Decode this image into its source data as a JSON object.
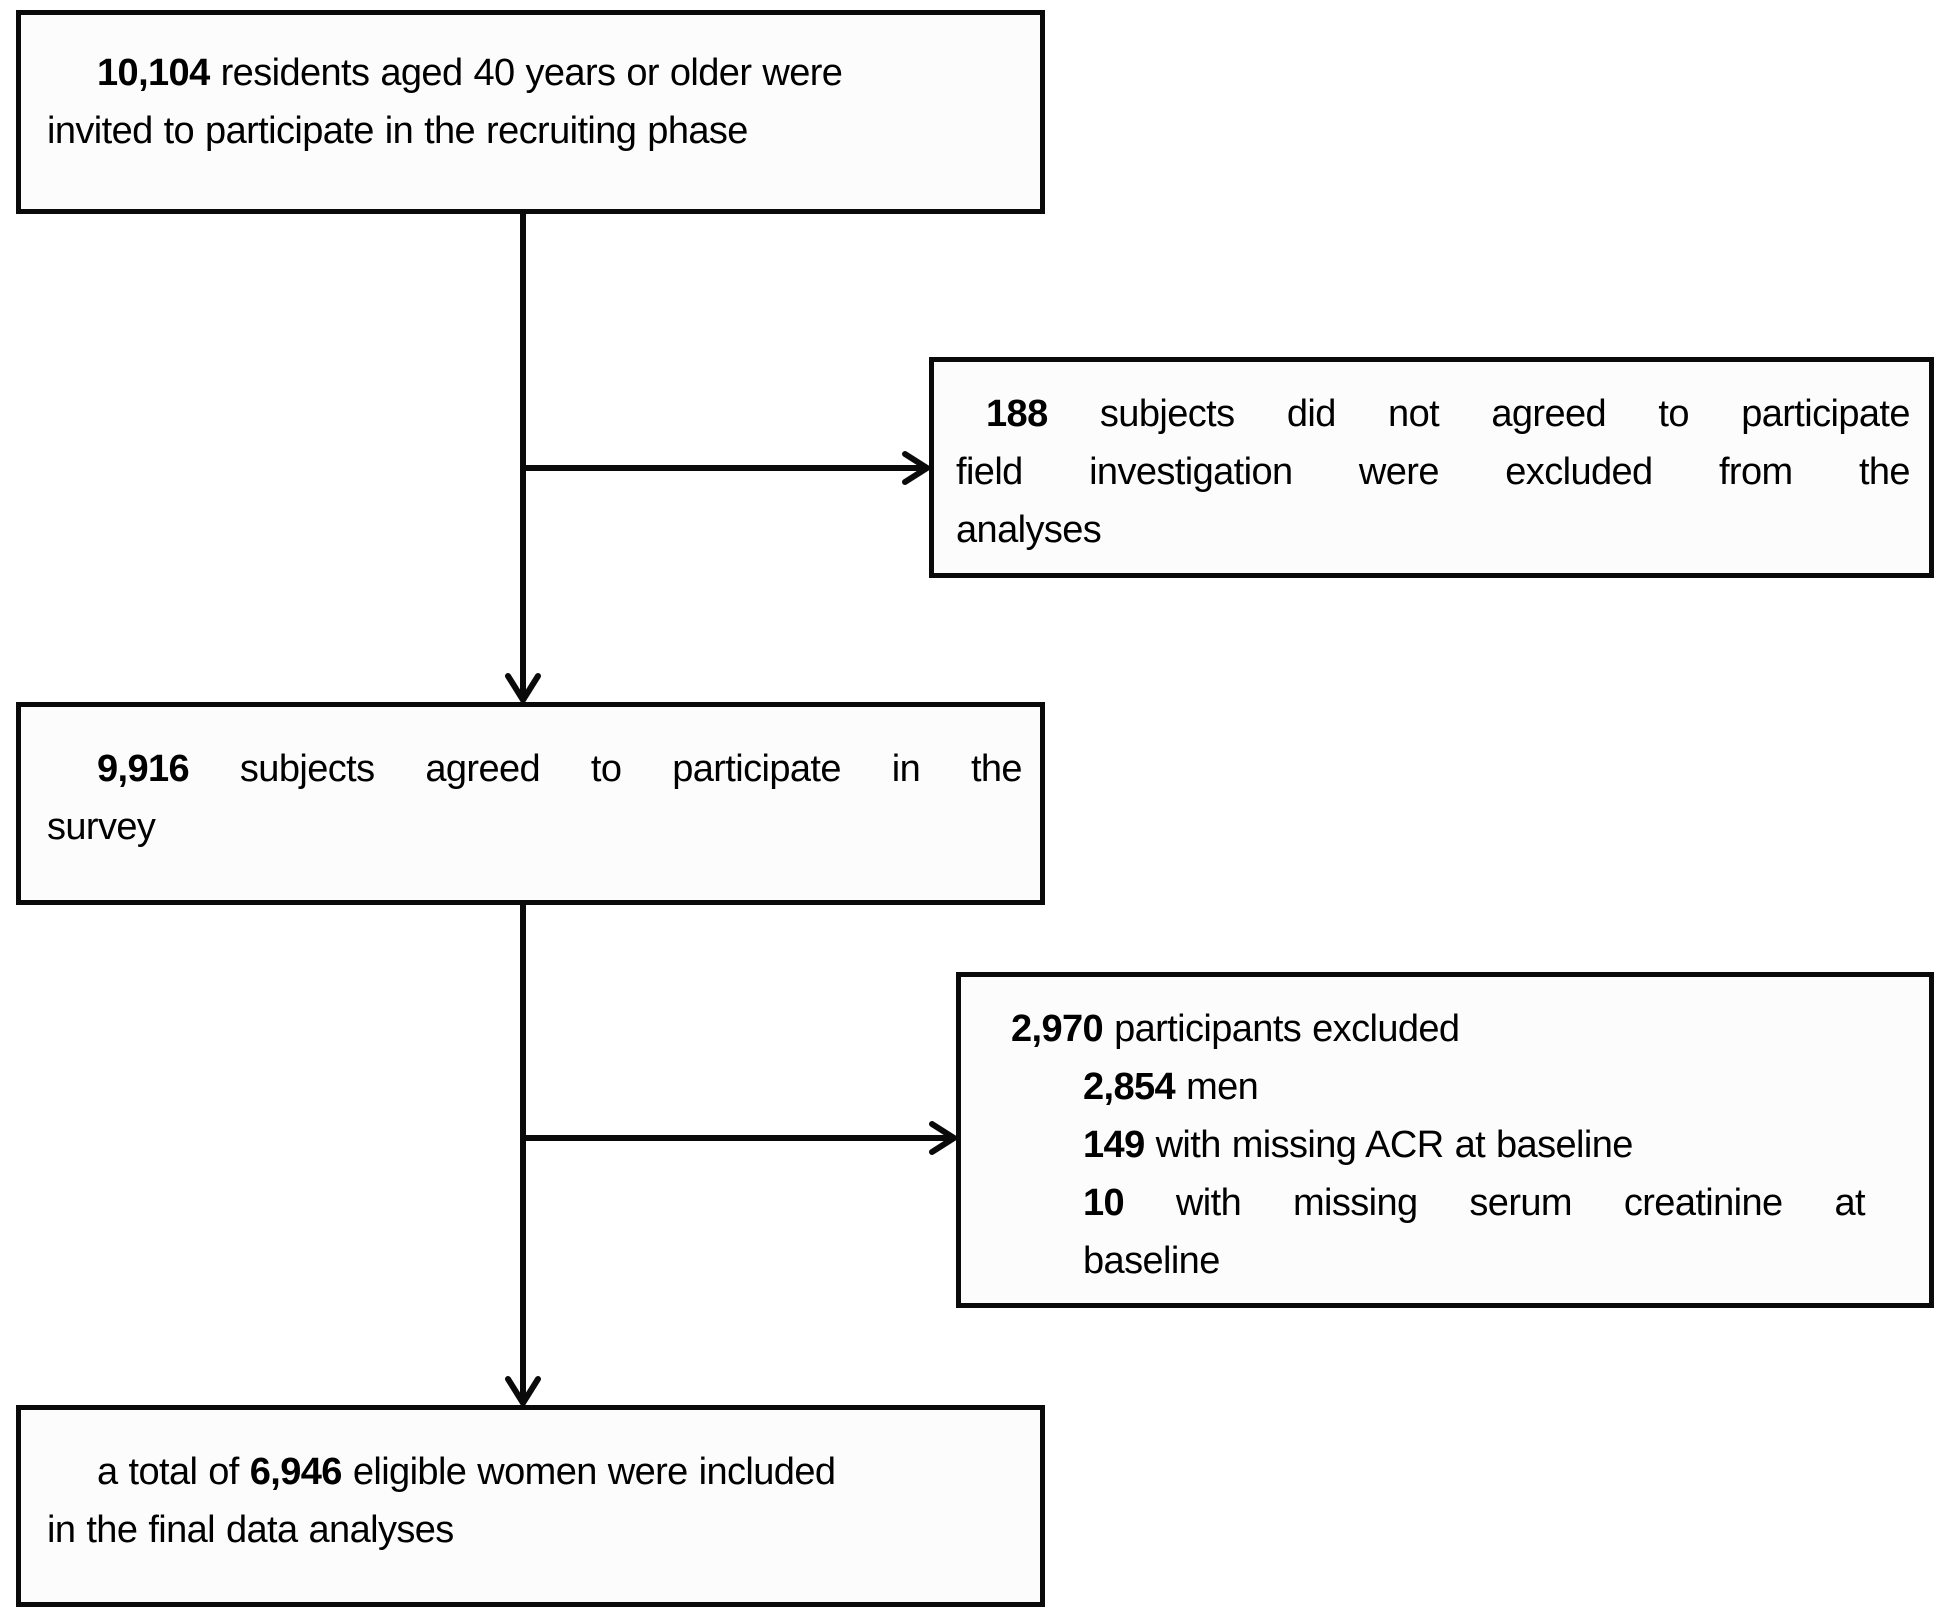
{
  "flowchart": {
    "type": "study-participant-flow",
    "boxes": {
      "invited": {
        "count": "10,104",
        "line1_rest": "residents aged 40 years or older were",
        "line2": "invited to participate in the recruiting phase"
      },
      "declined": {
        "count": "188",
        "line1_words": [
          "subjects",
          "did",
          "not",
          "agreed",
          "to",
          "participate"
        ],
        "line2_words": [
          "field",
          "investigation",
          "were",
          "excluded",
          "from",
          "the"
        ],
        "line3": "analyses"
      },
      "agreed": {
        "count": "9,916",
        "line1_words": [
          "subjects",
          "agreed",
          "to",
          "participate",
          "in",
          "the"
        ],
        "line2": "survey"
      },
      "excluded": {
        "count": "2,970",
        "label": "participants excluded",
        "reasons": [
          {
            "count": "2,854",
            "text": "men"
          },
          {
            "count": "149",
            "text": "with missing ACR at baseline"
          },
          {
            "count": "10",
            "text_words": [
              "with",
              "missing",
              "serum",
              "creatinine",
              "at"
            ],
            "text_cont": "baseline"
          }
        ]
      },
      "final": {
        "prefix": "a total of",
        "count": "6,946",
        "line1_rest": "eligible women were included",
        "line2": "in the final data analyses"
      }
    },
    "edges": [
      {
        "from": "invited",
        "to": "agreed",
        "type": "arrow"
      },
      {
        "from": "invited-agreed-line",
        "to": "declined",
        "type": "branch-arrow"
      },
      {
        "from": "agreed",
        "to": "final",
        "type": "arrow"
      },
      {
        "from": "agreed-final-line",
        "to": "excluded",
        "type": "branch-arrow"
      }
    ],
    "colors": {
      "stroke": "#0a0a0a",
      "box_fill": "#fcfcfc",
      "background": "#ffffff",
      "text": "#000000"
    }
  }
}
